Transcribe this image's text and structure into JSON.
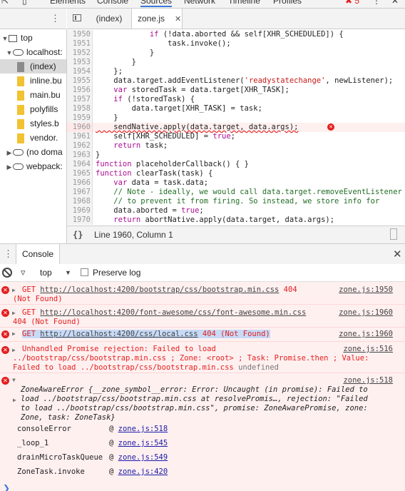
{
  "devtools_tabs": [
    "Elements",
    "Console",
    "Sources",
    "Network",
    "Timeline",
    "Profiles"
  ],
  "devtools_tabs_active": "Sources",
  "error_count": "5",
  "navigator": {
    "items": [
      {
        "label": "top",
        "indent": 0,
        "type": "frame",
        "expanded": true
      },
      {
        "label": "localhost:",
        "indent": 1,
        "type": "cloud",
        "expanded": true
      },
      {
        "label": "(index)",
        "indent": 2,
        "type": "file-gray",
        "selected": true
      },
      {
        "label": "inline.bu",
        "indent": 2,
        "type": "file"
      },
      {
        "label": "main.bu",
        "indent": 2,
        "type": "file"
      },
      {
        "label": "polyfills",
        "indent": 2,
        "type": "file"
      },
      {
        "label": "styles.b",
        "indent": 2,
        "type": "file"
      },
      {
        "label": "vendor.",
        "indent": 2,
        "type": "file"
      },
      {
        "label": "(no doma",
        "indent": 1,
        "type": "cloud",
        "expanded": false
      },
      {
        "label": "webpack:",
        "indent": 1,
        "type": "cloud",
        "expanded": false
      }
    ]
  },
  "editor_tabs": [
    {
      "label": "(index)",
      "active": false
    },
    {
      "label": "zone.js",
      "active": true
    }
  ],
  "code_lines": [
    {
      "n": "1950",
      "html": "            <span class='kw'>if</span> (!data.aborted &amp;&amp; self[XHR_SCHEDULED]) {"
    },
    {
      "n": "1951",
      "html": "                task.invoke();"
    },
    {
      "n": "1952",
      "html": "            }"
    },
    {
      "n": "1953",
      "html": "        }"
    },
    {
      "n": "1954",
      "html": "    };"
    },
    {
      "n": "1955",
      "html": "    data.target.addEventListener(<span class='str'>'readystatechange'</span>, newListener);"
    },
    {
      "n": "1956",
      "html": "    <span class='kw'>var</span> storedTask = data.target[XHR_TASK];"
    },
    {
      "n": "1957",
      "html": "    <span class='kw'>if</span> (!storedTask) {"
    },
    {
      "n": "1958",
      "html": "        data.target[XHR_TASK] = task;"
    },
    {
      "n": "1959",
      "html": "    }"
    },
    {
      "n": "1960",
      "html": "    sendNative.apply(data.target, data.args);",
      "err": true
    },
    {
      "n": "1961",
      "html": "    self[XHR_SCHEDULED] = <span class='kw'>true</span>;"
    },
    {
      "n": "1962",
      "html": "    <span class='kw'>return</span> task;"
    },
    {
      "n": "1963",
      "html": "}"
    },
    {
      "n": "1964",
      "html": "<span class='kw'>function</span> placeholderCallback() { }"
    },
    {
      "n": "1965",
      "html": "<span class='kw'>function</span> clearTask(task) {"
    },
    {
      "n": "1966",
      "html": "    <span class='kw'>var</span> data = task.data;"
    },
    {
      "n": "1967",
      "html": "    <span class='cm'>// Note - ideally, we would call data.target.removeEventListener</span>"
    },
    {
      "n": "1968",
      "html": "    <span class='cm'>// to prevent it from firing. So instead, we store info for</span>"
    },
    {
      "n": "1969",
      "html": "    data.aborted = <span class='kw'>true</span>;"
    },
    {
      "n": "1970",
      "html": "    <span class='kw'>return</span> abortNative.apply(data.target, data.args);"
    }
  ],
  "status": {
    "icon": "{}",
    "position": "Line 1960, Column 1"
  },
  "drawer": {
    "tab": "Console"
  },
  "console_toolbar": {
    "context": "top",
    "preserve_log": "Preserve log"
  },
  "messages": [
    {
      "line1": "GET",
      "url": "http://localhost:4200/bootstrap/css/bootstrap.min.css",
      "status": "404",
      "line2": "(Not Found)",
      "src": "zone.js:1950"
    },
    {
      "line1": "GET",
      "url": "http://localhost:4200/font-awesome/css/font-awesome.min.css",
      "status": "",
      "line2": "404 (Not Found)",
      "src": "zone.js:1960"
    },
    {
      "line1": "GET",
      "url": "http://localhost:4200/css/local.css",
      "status": "404 (Not Found)",
      "src": "zone.js:1960"
    },
    {
      "text1": "Unhandled Promise rejection: Failed to load",
      "text2": "../bootstrap/css/bootstrap.min.css ; Zone: <root> ; Task: Promise.then ; Value:",
      "text3": "Failed to load ../bootstrap/css/bootstrap.min.css",
      "text3b": "undefined",
      "src": "zone.js:516"
    },
    {
      "src": "zone.js:518",
      "l1": "ZoneAwareError {__zone_symbol__error: Error: Uncaught (in promise): Failed to",
      "l2": "load ../bootstrap/css/bootstrap.min.css at resolvePromis…, rejection: \"Failed",
      "l3": "to load ../bootstrap/css/bootstrap.min.css\", promise: ZoneAwarePromise, zone:",
      "l4": "Zone, task: ZoneTask}"
    }
  ],
  "stack": [
    {
      "fn": "consoleError",
      "link": "zone.js:518"
    },
    {
      "fn": "_loop_1",
      "link": "zone.js:545"
    },
    {
      "fn": "drainMicroTaskQueue",
      "link": "zone.js:549"
    },
    {
      "fn": "ZoneTask.invoke",
      "link": "zone.js:420"
    }
  ]
}
